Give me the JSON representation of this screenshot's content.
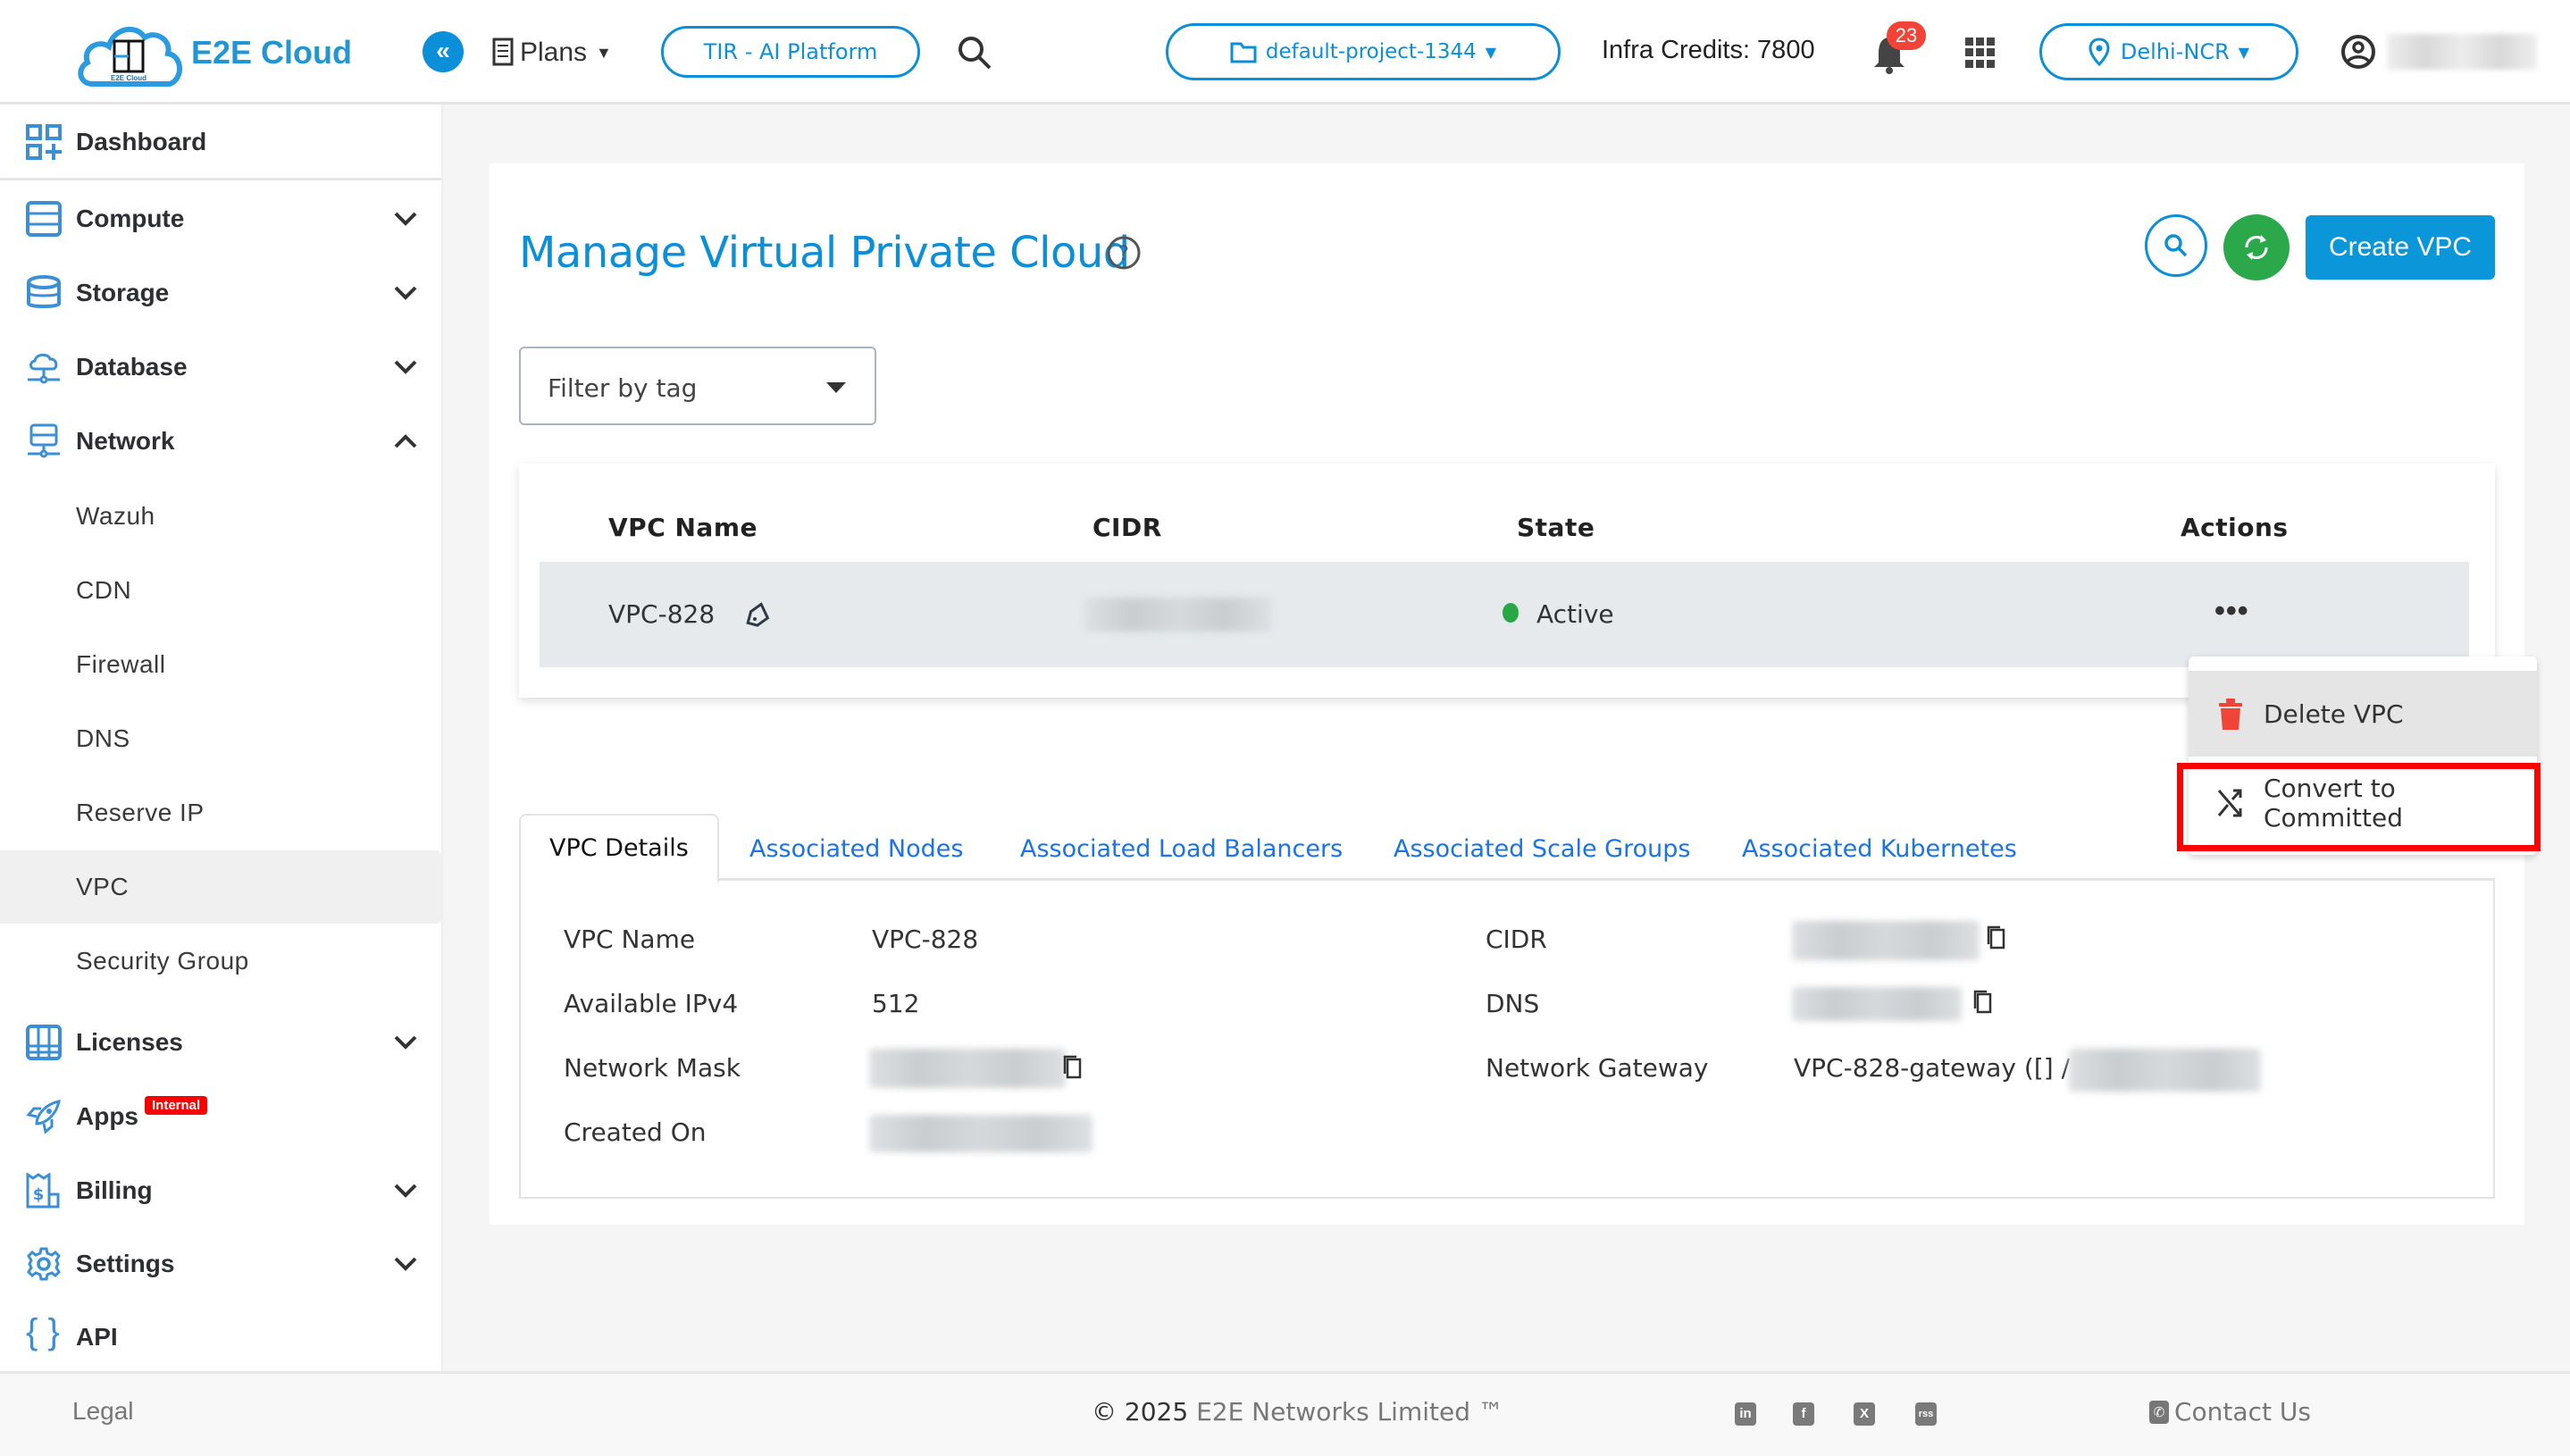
{
  "header": {
    "brand": "E2E Cloud",
    "logo_caption": "E2E Cloud",
    "collapse_label": "«",
    "plans_label": "Plans",
    "tir_label": "TIR - AI Platform",
    "project_label": "default-project-1344",
    "credits_label": "Infra Credits: 7800",
    "notification_count": "23",
    "region_label": "Delhi-NCR"
  },
  "sidebar": {
    "items": [
      {
        "label": "Dashboard",
        "icon": "dashboard-icon"
      },
      {
        "label": "Compute",
        "icon": "server-icon"
      },
      {
        "label": "Storage",
        "icon": "database-stack-icon"
      },
      {
        "label": "Database",
        "icon": "cloud-network-icon"
      },
      {
        "label": "Network",
        "icon": "network-server-icon"
      },
      {
        "label": "Licenses",
        "icon": "licenses-icon"
      },
      {
        "label": "Apps",
        "icon": "rocket-icon",
        "badge": "Internal"
      },
      {
        "label": "Billing",
        "icon": "billing-icon"
      },
      {
        "label": "Settings",
        "icon": "gear-icon"
      },
      {
        "label": "API",
        "icon": "braces-icon"
      }
    ],
    "network_sub": [
      "Wazuh",
      "CDN",
      "Firewall",
      "DNS",
      "Reserve IP",
      "VPC",
      "Security Group"
    ],
    "active_sub": "VPC"
  },
  "main": {
    "title": "Manage Virtual Private Cloud",
    "create_label": "Create VPC",
    "filter_placeholder": "Filter by tag",
    "table": {
      "headers": [
        "VPC Name",
        "CIDR",
        "State",
        "Actions"
      ],
      "rows": [
        {
          "name": "VPC-828",
          "cidr": "[redacted]",
          "state": "Active",
          "actions": "•••"
        }
      ]
    },
    "menu": {
      "items": [
        {
          "label": "Delete VPC",
          "icon": "trash-icon"
        },
        {
          "label": "Convert to Committed",
          "icon": "shuffle-icon"
        }
      ]
    },
    "tabs": [
      "VPC Details",
      "Associated Nodes",
      "Associated Load Balancers",
      "Associated Scale Groups",
      "Associated Kubernetes"
    ],
    "active_tab": "VPC Details",
    "details": {
      "left": [
        {
          "label": "VPC Name",
          "value": "VPC-828"
        },
        {
          "label": "Available IPv4",
          "value": "512"
        },
        {
          "label": "Network Mask",
          "value": "[redacted]"
        },
        {
          "label": "Created On",
          "value": "[redacted]"
        }
      ],
      "right": [
        {
          "label": "CIDR",
          "value": "[redacted]"
        },
        {
          "label": "DNS",
          "value": "[redacted]"
        },
        {
          "label": "Network Gateway",
          "value": "VPC-828-gateway ([] /"
        }
      ]
    }
  },
  "footer": {
    "legal": "Legal",
    "copyright_year": "© 2025",
    "copyright_text": "E2E Networks Limited ™",
    "social": [
      "in",
      "f",
      "X",
      "rss"
    ],
    "contact": "Contact Us"
  },
  "colors": {
    "accent": "#0b8fd8",
    "success": "#28a745",
    "danger": "#f24336",
    "highlight": "#ff0000"
  }
}
